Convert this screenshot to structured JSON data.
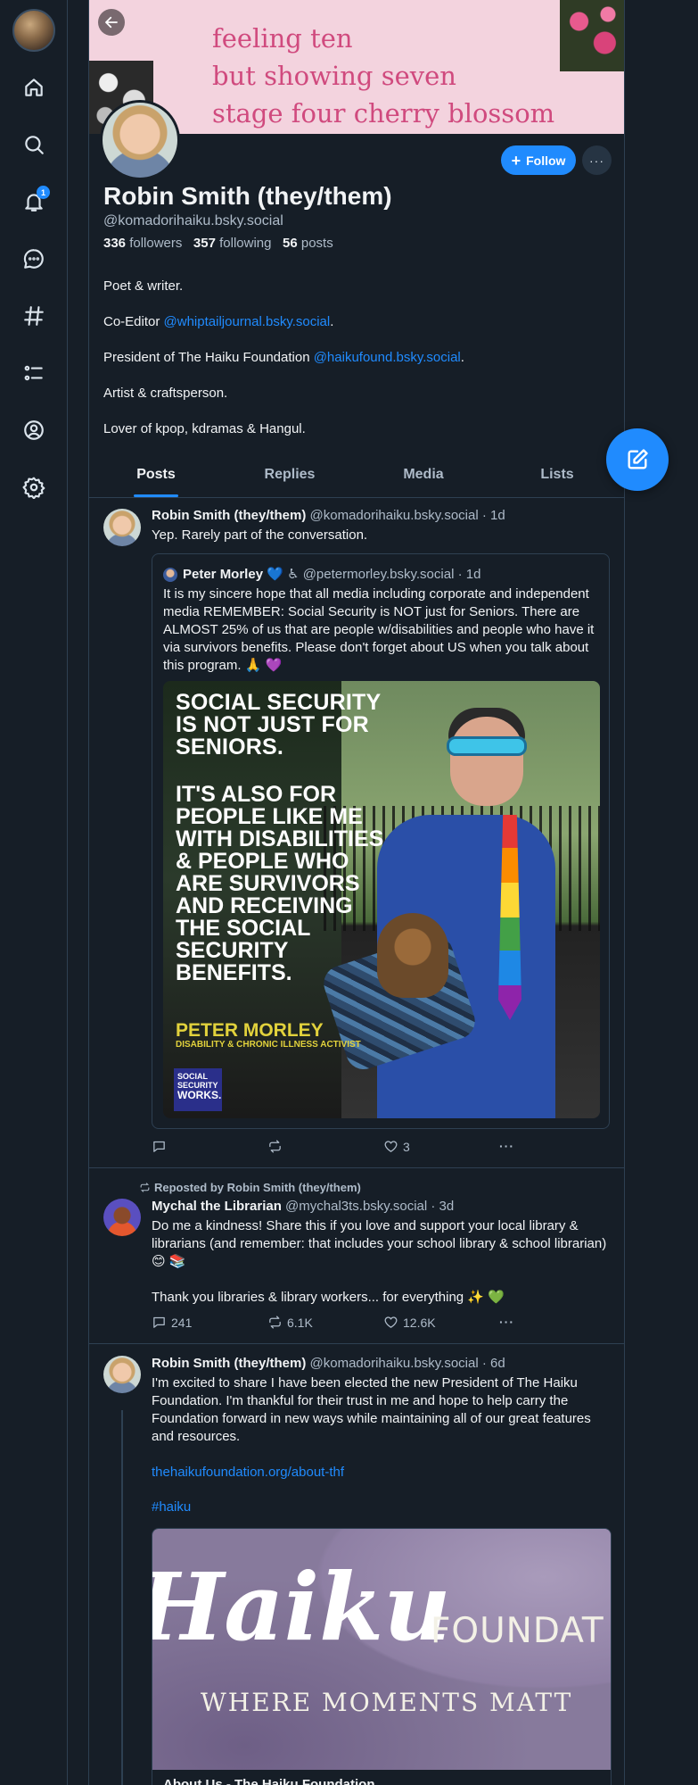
{
  "nav": {
    "notifications_badge": "1",
    "icons": [
      "home-icon",
      "search-icon",
      "bell-icon",
      "chat-icon",
      "hashtag-icon",
      "list-icon",
      "profile-icon",
      "gear-icon"
    ]
  },
  "profile": {
    "banner_lines": [
      "feeling ten",
      "but showing seven",
      "stage four cherry blossom"
    ],
    "name": "Robin Smith (they/them)",
    "handle": "@komadorihaiku.bsky.social",
    "followers_count": "336",
    "followers_label": "followers",
    "following_count": "357",
    "following_label": "following",
    "posts_count": "56",
    "posts_label": "posts",
    "follow_label": "Follow",
    "more_label": "···",
    "bio": {
      "line1": "Poet & writer.",
      "line2_prefix": "Co-Editor ",
      "line2_link": "@whiptailjournal.bsky.social",
      "line2_suffix": ".",
      "line3_prefix": "President of The Haiku Foundation ",
      "line3_link": "@haikufound.bsky.social",
      "line3_suffix": ".",
      "line4": "Artist & craftsperson.",
      "line5": "Lover of kpop, kdramas & Hangul."
    }
  },
  "tabs": [
    {
      "label": "Posts",
      "active": true
    },
    {
      "label": "Replies",
      "active": false
    },
    {
      "label": "Media",
      "active": false
    },
    {
      "label": "Lists",
      "active": false
    }
  ],
  "posts": [
    {
      "author": "Robin Smith (they/them)",
      "meta": "@komadorihaiku.bsky.social · 1d",
      "text": "Yep. Rarely part of the conversation.",
      "quote": {
        "author": "Peter Morley",
        "badges": "💙 ♿",
        "meta": "@petermorley.bsky.social · 1d",
        "text": "It is my sincere hope that all media including corporate and independent media REMEMBER: Social Security is NOT just for Seniors. There are ALMOST 25% of us that are people w/disabilities and people who have it via survivors benefits. Please don't forget about US when you talk about this program. 🙏 💜",
        "image_text": {
          "headline": "SOCIAL SECURITY IS NOT JUST FOR SENIORS.",
          "body": "IT'S ALSO FOR PEOPLE LIKE ME WITH DISABILITIES & PEOPLE WHO ARE SURVIVORS AND RECEIVING THE SOCIAL SECURITY BENEFITS.",
          "name": "PETER MORLEY",
          "title": "DISABILITY & CHRONIC ILLNESS ACTIVIST",
          "logo_line1": "SOCIAL",
          "logo_line2": "SECURITY",
          "logo_line3": "WORKS."
        }
      },
      "likes": "3"
    },
    {
      "reposted_by": "Reposted by Robin Smith (they/them)",
      "author": "Mychal the Librarian",
      "meta": "@mychal3ts.bsky.social · 3d",
      "text": "Do me a kindness! Share this if you love and support your local library & librarians (and remember: that includes your school library & school librarian) 😊 📚",
      "text2": "Thank you libraries & library workers... for everything ✨ 💚",
      "replies": "241",
      "reposts": "6.1K",
      "likes": "12.6K"
    },
    {
      "author": "Robin Smith (they/them)",
      "meta": "@komadorihaiku.bsky.social · 6d",
      "text": "I'm excited to share I have been elected the new President of The Haiku Foundation. I'm thankful for their trust in me and hope to help carry the Foundation forward in new ways while maintaining all of our great features and resources.",
      "link": "thehaikufoundation.org/about-thf",
      "hashtag": "#haiku",
      "card": {
        "logo_word": "Haiku",
        "logo_found": "FOUNDAT",
        "tagline": "WHERE MOMENTS MATT",
        "title": "About Us - The Haiku Foundation"
      }
    }
  ],
  "colors": {
    "background": "#161e27",
    "accent": "#208bfe",
    "border": "#2e4052",
    "muted_text": "#aebbc9",
    "banner": "#f3d3de",
    "banner_text": "#d04a7e"
  }
}
